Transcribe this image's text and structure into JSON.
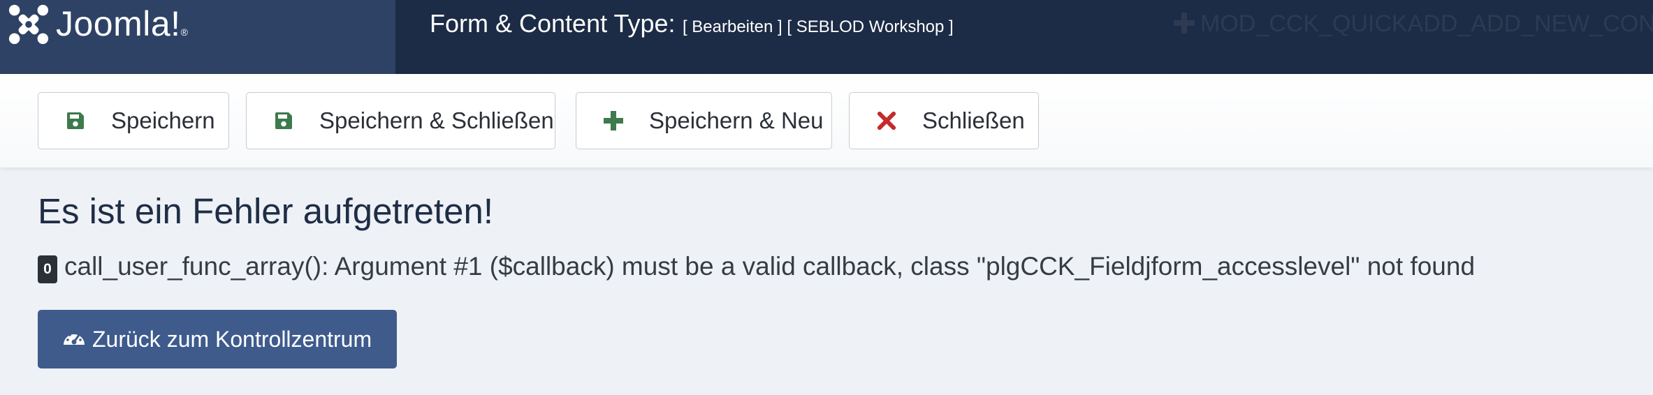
{
  "header": {
    "logo_text": "Joomla!",
    "logo_reg": "®",
    "title": "Form & Content Type:",
    "title_sub": "[ Bearbeiten ] [ SEBLOD Workshop ]",
    "quickadd_label": "MOD_CCK_QUICKADD_ADD_NEW_CONTENT"
  },
  "toolbar": {
    "save_label": "Speichern",
    "save_close_label": "Speichern & Schließen",
    "save_new_label": "Speichern & Neu",
    "close_label": "Schließen"
  },
  "error": {
    "title": "Es ist ein Fehler aufgetreten!",
    "code": "0",
    "message": "call_user_func_array(): Argument #1 ($callback) must be a valid callback, class \"plgCCK_Fieldjform_accesslevel\" not found"
  },
  "back_button": {
    "label": "Zurück zum Kontrollzentrum"
  },
  "icons": {
    "logo": "joomla-logo-icon",
    "save": "floppy-disk-icon",
    "save_new": "plus-icon",
    "close": "x-icon",
    "back": "dashboard-gauge-icon"
  },
  "colors": {
    "header_bg": "#1c2b46",
    "logo_bg": "#2e4266",
    "save_icon": "#3d7a4c",
    "close_icon": "#c52b2b",
    "back_button_bg": "#3e5b8c"
  }
}
